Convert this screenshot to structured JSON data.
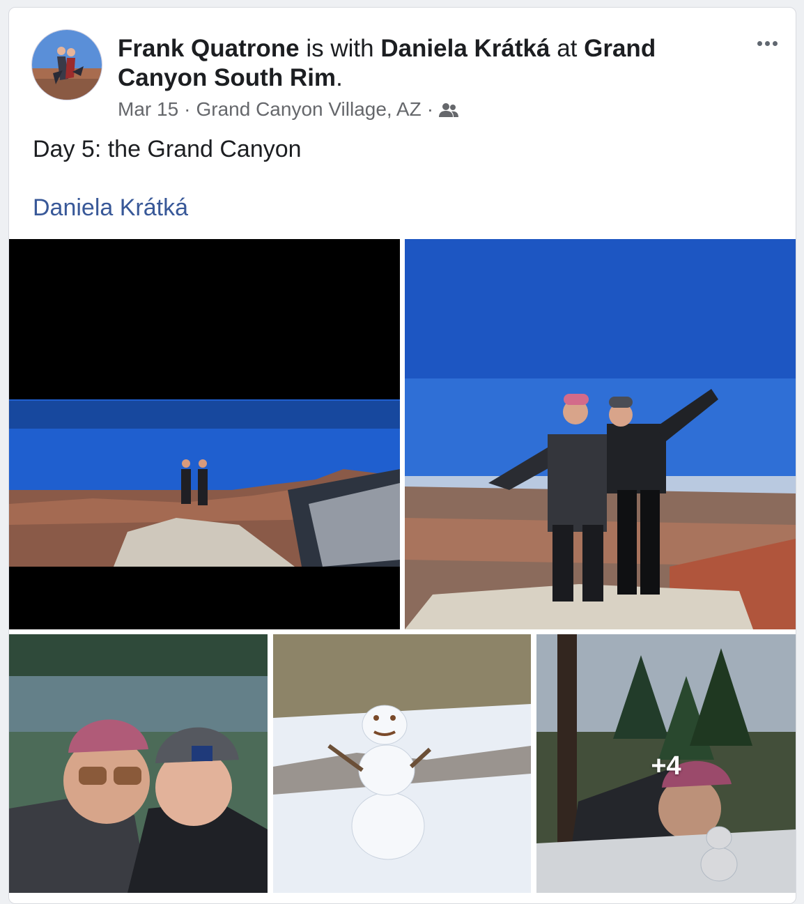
{
  "post": {
    "author": "Frank Quatrone",
    "with_text": " is with ",
    "tagged_person": "Daniela Krátká",
    "at_text": " at ",
    "place": "Grand Canyon South Rim",
    "period": ".",
    "date": "Mar 15",
    "separator": "·",
    "location": "Grand Canyon Village, AZ",
    "audience_icon": "friends-icon",
    "body": "Day 5: the Grand Canyon",
    "tag_link": "Daniela Krátká",
    "more_options_icon": "more-options-icon"
  },
  "photos": {
    "remaining_count": "+4"
  },
  "colors": {
    "link": "#385898",
    "text": "#1c1e21",
    "meta": "#65676b"
  }
}
